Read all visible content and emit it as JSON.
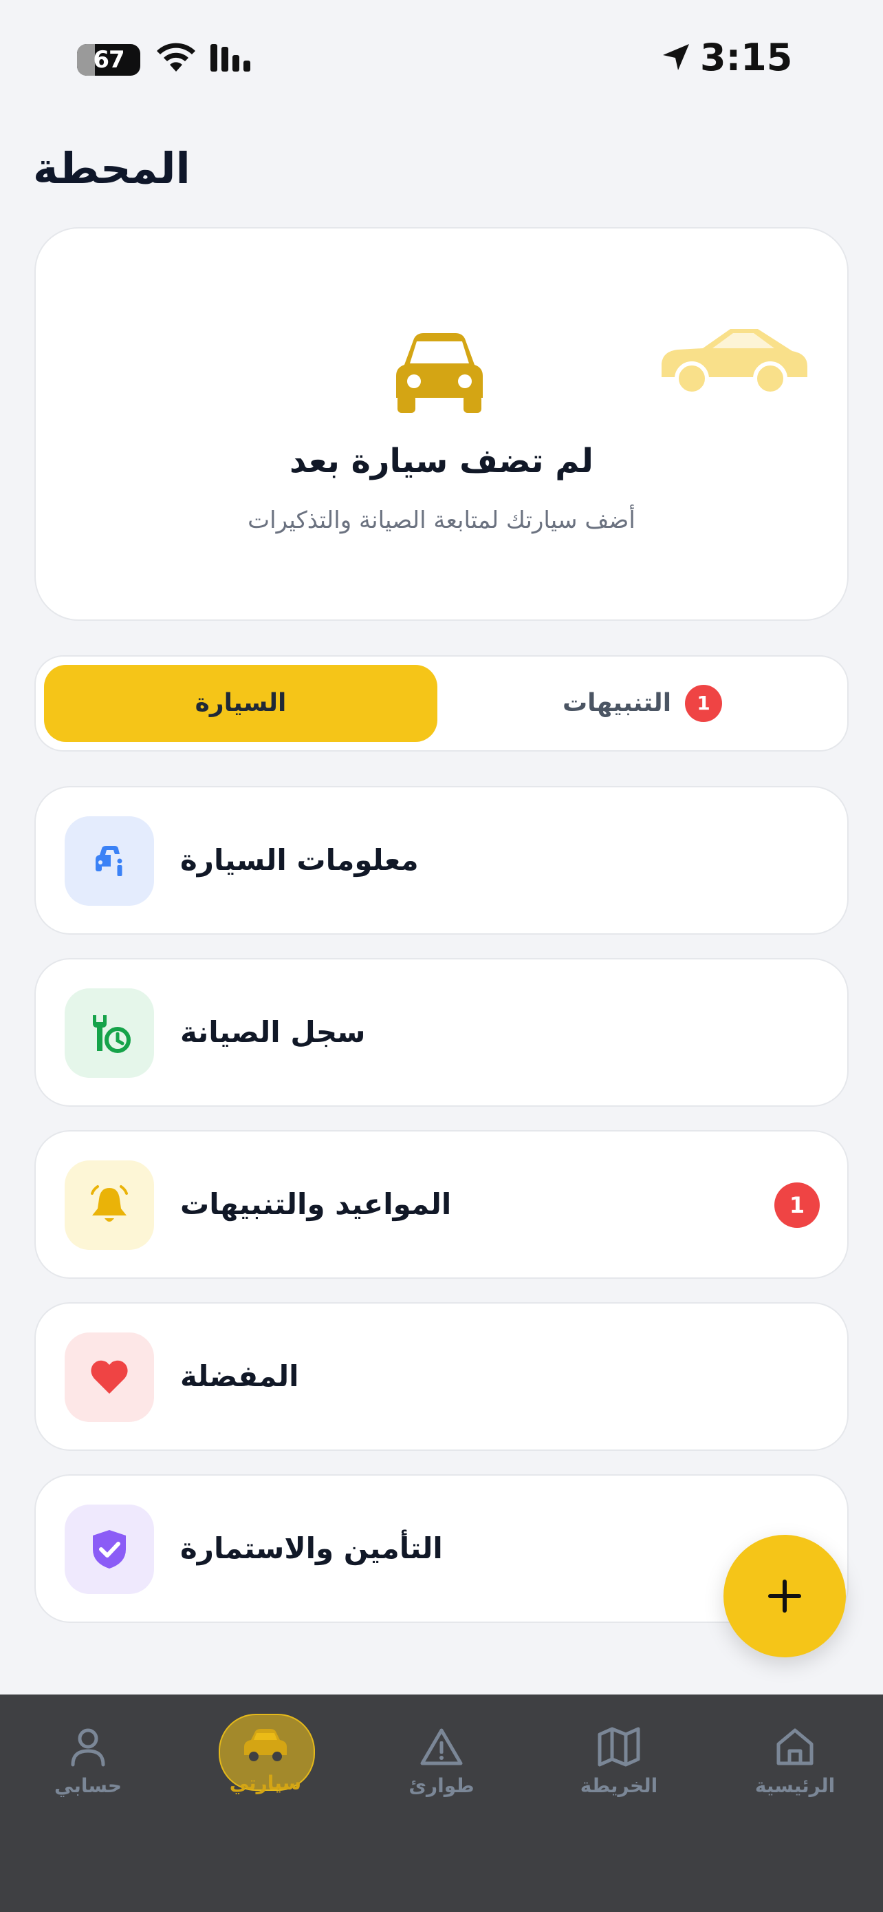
{
  "status_bar": {
    "battery": "67",
    "time": "3:15"
  },
  "page": {
    "title": "المحطة"
  },
  "hero": {
    "title": "لم تضف سيارة بعد",
    "subtitle": "أضف سيارتك لمتابعة الصيانة والتذكيرات"
  },
  "tabs": {
    "car": "السيارة",
    "alerts": "التنبيهات",
    "alerts_badge": "1"
  },
  "menu": {
    "car_info": "معلومات السيارة",
    "maintenance": "سجل الصيانة",
    "appointments": "المواعيد والتنبيهات",
    "appointments_badge": "1",
    "favorites": "المفضلة",
    "insurance": "التأمين والاستمارة"
  },
  "bottom_nav": {
    "account": "حسابي",
    "my_car": "سيارتي",
    "emergency": "طوارئ",
    "map": "الخريطة",
    "home": "الرئيسية"
  },
  "colors": {
    "accent": "#f5c518",
    "badge": "#ef4444",
    "nav_bg": "#3f4043"
  },
  "icons": {
    "car_info": "car-info-icon",
    "maintenance": "wrench-clock-icon",
    "appointments": "bell-icon",
    "favorites": "heart-icon",
    "insurance": "shield-check-icon",
    "fab": "plus-icon"
  }
}
